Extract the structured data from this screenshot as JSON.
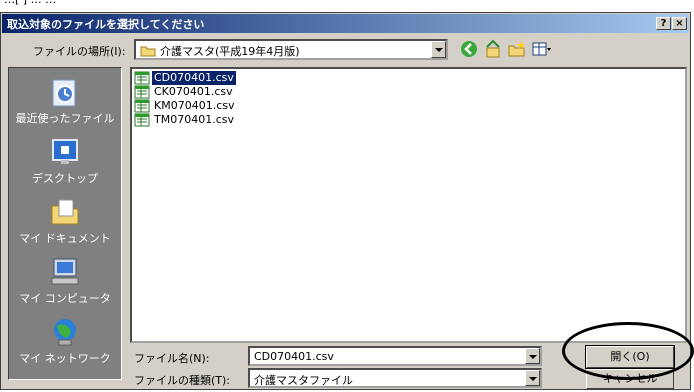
{
  "dialog": {
    "title": "取込対象のファイルを選択してください",
    "help_label": "?",
    "close_label": "×"
  },
  "top_fragment": "…[ ] … …",
  "location": {
    "label": "ファイルの場所(I):",
    "value": "介護マスタ(平成19年4月版)"
  },
  "places": [
    {
      "label": "最近使ったファイル",
      "icon": "recent-icon"
    },
    {
      "label": "デスクトップ",
      "icon": "desktop-icon"
    },
    {
      "label": "マイ ドキュメント",
      "icon": "my-documents-icon"
    },
    {
      "label": "マイ コンピュータ",
      "icon": "my-computer-icon"
    },
    {
      "label": "マイ ネットワーク",
      "icon": "my-network-icon"
    }
  ],
  "files": [
    {
      "name": "CD070401.csv",
      "selected": true
    },
    {
      "name": "CK070401.csv",
      "selected": false
    },
    {
      "name": "KM070401.csv",
      "selected": false
    },
    {
      "name": "TM070401.csv",
      "selected": false
    }
  ],
  "filename": {
    "label": "ファイル名(N):",
    "value": "CD070401.csv"
  },
  "filetype": {
    "label": "ファイルの種類(T):",
    "value": "介護マスタファイル"
  },
  "buttons": {
    "open": "開く(O)",
    "cancel": "キャンセル"
  },
  "colors": {
    "titlebar": "#0a246a",
    "face": "#d4d0c8",
    "places_bg": "#808080",
    "selection": "#0a246a"
  }
}
